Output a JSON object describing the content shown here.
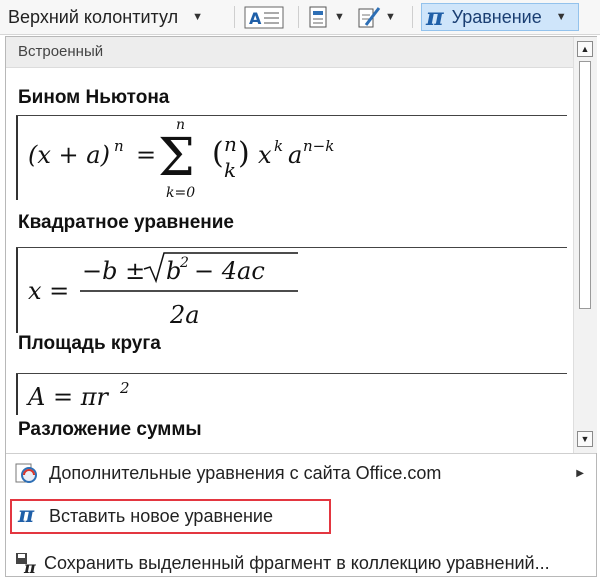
{
  "ribbon": {
    "header_label": "Верхний колонтитул",
    "equation_label": "Уравнение"
  },
  "gallery": {
    "section_title": "Встроенный",
    "items": [
      {
        "title": "Бином Ньютона"
      },
      {
        "title": "Квадратное уравнение"
      },
      {
        "title": "Площадь круга"
      },
      {
        "title": "Разложение суммы"
      }
    ]
  },
  "menu": {
    "more_equations": "Дополнительные уравнения с сайта  Office.com",
    "insert_new": "Вставить новое уравнение",
    "save_selection": "Сохранить выделенный фрагмент в коллекцию уравнений..."
  },
  "icons": [
    "chevron-down-icon",
    "text-box-icon",
    "quick-parts-icon",
    "signature-icon",
    "pi-icon",
    "office-com-icon",
    "save-equation-icon",
    "chevron-right-icon"
  ],
  "colors": {
    "accent": "#1f5fa8",
    "highlight_border": "#e33640",
    "button_selected": "#cfe5fa"
  }
}
